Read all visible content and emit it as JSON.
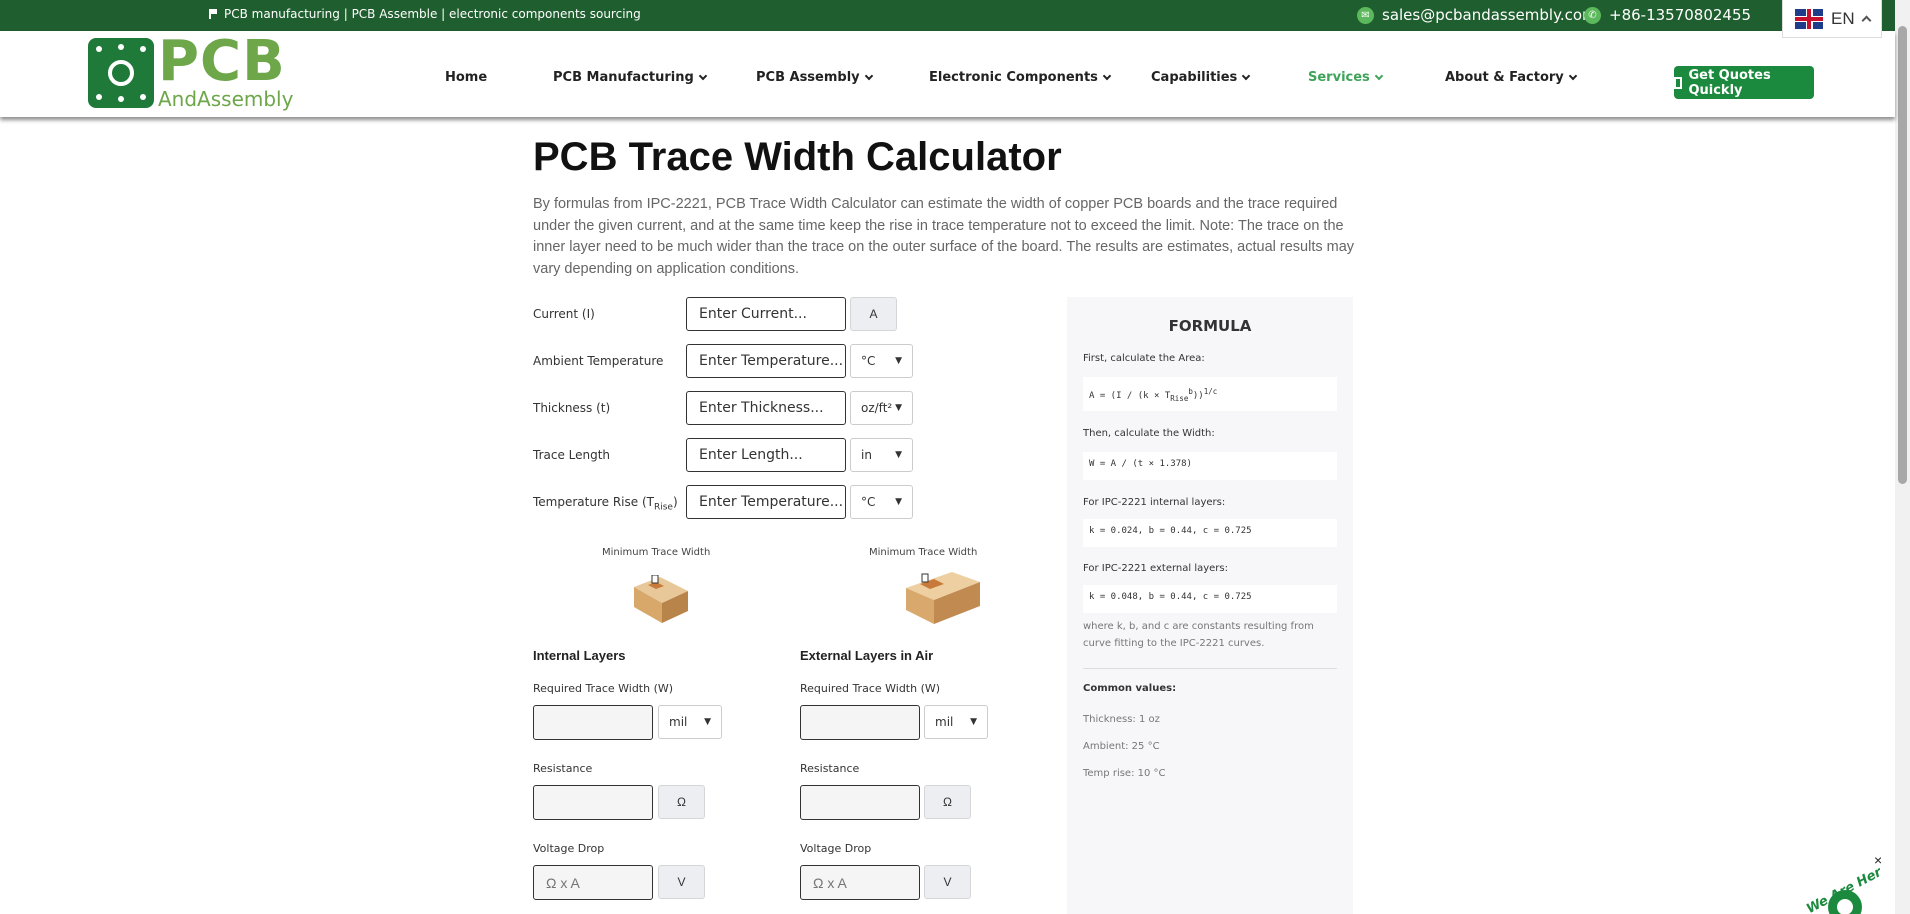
{
  "topbar": {
    "tagline": "PCB manufacturing | PCB Assemble | electronic components sourcing",
    "email": "sales@pcbandassembly.com",
    "phone": "+86-13570802455",
    "language": "EN"
  },
  "logo": {
    "line1": "PCB",
    "line2": "AndAssembly"
  },
  "nav": [
    {
      "label": "Home"
    },
    {
      "label": "PCB Manufacturing"
    },
    {
      "label": "PCB Assembly"
    },
    {
      "label": "Electronic Components"
    },
    {
      "label": "Capabilities"
    },
    {
      "label": "Services"
    },
    {
      "label": "About & Factory"
    }
  ],
  "quote_button": "Get Quotes Quickly",
  "page": {
    "title": "PCB Trace Width Calculator",
    "intro": "By formulas from IPC-2221, PCB Trace Width Calculator can estimate the width of copper PCB boards and the trace required under the given current, and at the same time keep the rise in trace temperature not to exceed the limit. Note: The trace on the inner layer need to be much wider than the trace on the outer surface of the board. The results are estimates, actual results may vary depending on application conditions."
  },
  "inputs": {
    "current": {
      "label": "Current (I)",
      "placeholder": "Enter Current...",
      "unit": "A"
    },
    "ambient": {
      "label": "Ambient Temperature",
      "placeholder": "Enter Temperature...",
      "unit": "°C"
    },
    "thickness": {
      "label": "Thickness (t)",
      "placeholder": "Enter Thickness...",
      "unit": "oz/ft²"
    },
    "length": {
      "label": "Trace Length",
      "placeholder": "Enter Length...",
      "unit": "in"
    },
    "rise": {
      "label_main": "Temperature Rise (T",
      "label_sub": "Rise",
      "label_end": ")",
      "placeholder": "Enter Temperature...",
      "unit": "°C"
    }
  },
  "diagrams": {
    "left_label": "Minimum Trace Width",
    "right_label": "Minimum Trace Width"
  },
  "internal": {
    "heading": "Internal Layers",
    "width_label": "Required Trace Width (W)",
    "width_unit": "mil",
    "resistance_label": "Resistance",
    "resistance_unit": "Ω",
    "voltage_label": "Voltage Drop",
    "voltage_placeholder": "Ω x A",
    "voltage_unit": "V"
  },
  "external": {
    "heading": "External Layers in Air",
    "width_label": "Required Trace Width (W)",
    "width_unit": "mil",
    "resistance_label": "Resistance",
    "resistance_unit": "Ω",
    "voltage_label": "Voltage Drop",
    "voltage_placeholder": "Ω x A",
    "voltage_unit": "V"
  },
  "formula": {
    "heading": "FORMULA",
    "step1": "First, calculate the Area:",
    "area_main": "A = (I / (k × T",
    "area_sub": "Rise",
    "area_sup1": "b",
    "area_end": "))",
    "area_sup2": "1/c",
    "step2": "Then, calculate the Width:",
    "width_formula": "W = A / (t × 1.378)",
    "internal_title": "For IPC-2221 internal layers:",
    "internal_consts": "k = 0.024, b = 0.44, c = 0.725",
    "external_title": "For IPC-2221 external layers:",
    "external_consts": "k = 0.048, b = 0.44, c = 0.725",
    "note": "where k, b, and c are constants resulting from curve fitting to the IPC-2221 curves.",
    "common_heading": "Common values:",
    "common": [
      "Thickness: 1 oz",
      "Ambient: 25 °C",
      "Temp rise: 10 °C"
    ]
  },
  "chat": {
    "text": "We Are Here!",
    "close": "×"
  },
  "colors": {
    "topbar": "#1f5e2e",
    "brand_green": "#1c8a3e",
    "logo_green": "#6ea64a",
    "active_nav": "#3fa35a"
  }
}
